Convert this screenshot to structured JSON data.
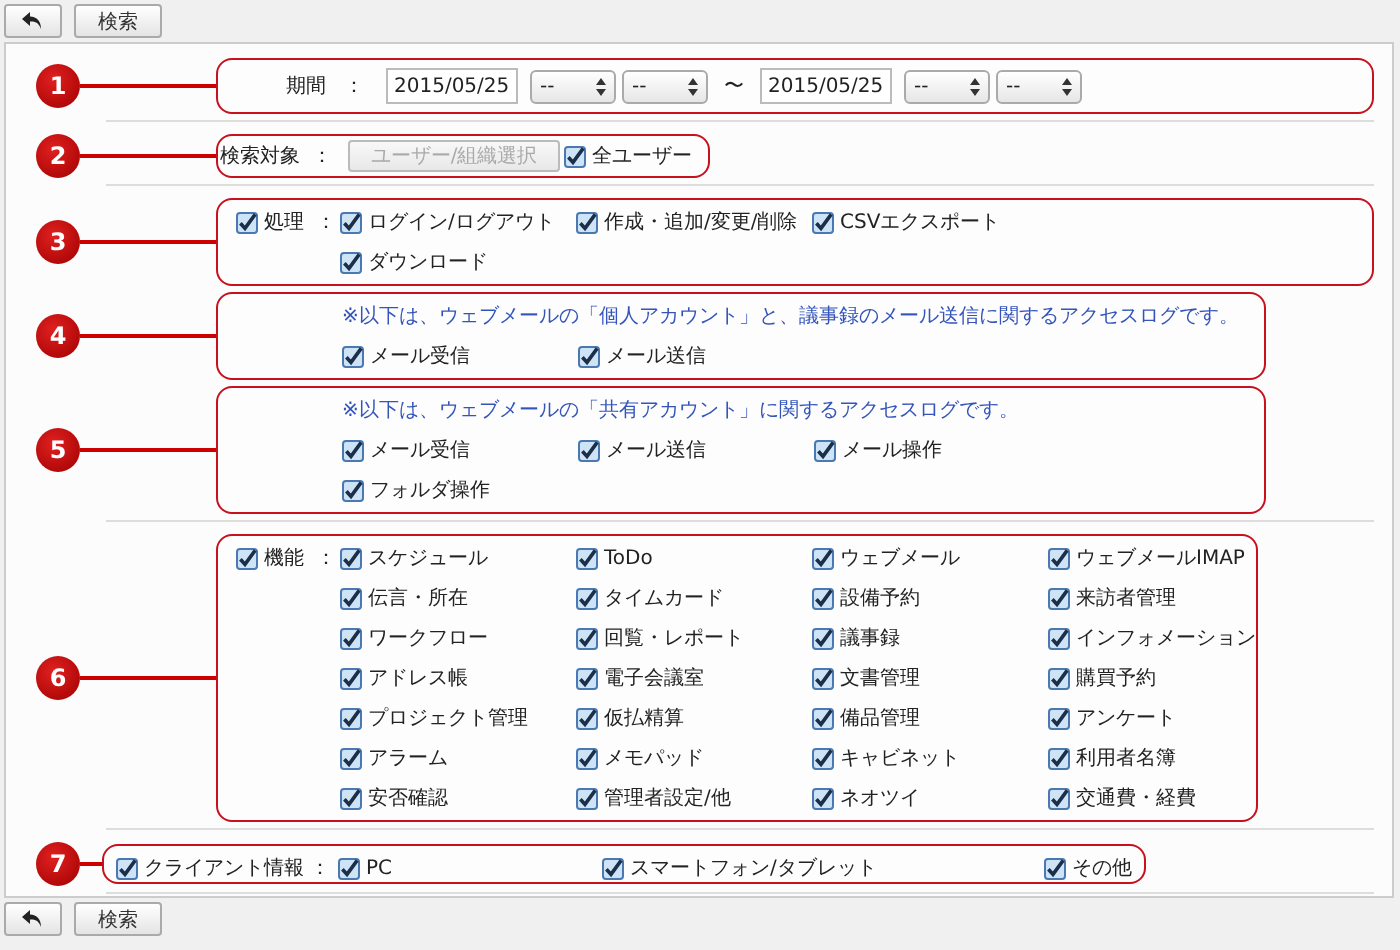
{
  "top_toolbar": {
    "search_button": "検索"
  },
  "rows": [
    {
      "sections": [
        {
          "kind": "period",
          "number": "1",
          "label": "期間",
          "colon": "：",
          "from": {
            "date": "2015/05/25",
            "hour": "--",
            "minute": "--"
          },
          "tilde": "〜",
          "to": {
            "date": "2015/05/25",
            "hour": "--",
            "minute": "--"
          }
        }
      ]
    },
    {
      "sections": [
        {
          "kind": "target",
          "number": "2",
          "label": "検索対象",
          "colon": "：",
          "button": {
            "label": "ユーザー/組織選択",
            "disabled": true
          },
          "all_users": {
            "label": "全ユーザー",
            "checked": true
          }
        }
      ]
    },
    {
      "sections": [
        {
          "kind": "checks",
          "number": "3",
          "label": "処理",
          "checked": true,
          "colon": "：",
          "items": [
            {
              "label": "ログイン/ログアウト",
              "checked": true
            },
            {
              "label": "作成・追加/変更/削除",
              "checked": true
            },
            {
              "label": "CSVエクスポート",
              "checked": true
            },
            {
              "label": "ダウンロード",
              "checked": true
            }
          ]
        },
        {
          "kind": "notice",
          "number": "4",
          "note": "※以下は、ウェブメールの「個人アカウント」と、議事録のメール送信に関するアクセスログです。",
          "items": [
            {
              "label": "メール受信",
              "checked": true
            },
            {
              "label": "メール送信",
              "checked": true
            }
          ]
        },
        {
          "kind": "notice",
          "number": "5",
          "note": "※以下は、ウェブメールの「共有アカウント」に関するアクセスログです。",
          "items": [
            {
              "label": "メール受信",
              "checked": true
            },
            {
              "label": "メール送信",
              "checked": true
            },
            {
              "label": "メール操作",
              "checked": true
            },
            {
              "label": "フォルダ操作",
              "checked": true
            }
          ]
        }
      ]
    },
    {
      "sections": [
        {
          "kind": "checks",
          "number": "6",
          "label": "機能",
          "checked": true,
          "colon": "：",
          "items": [
            {
              "label": "スケジュール",
              "checked": true
            },
            {
              "label": "ToDo",
              "checked": true
            },
            {
              "label": "ウェブメール",
              "checked": true
            },
            {
              "label": "ウェブメールIMAP",
              "checked": true
            },
            {
              "label": "伝言・所在",
              "checked": true
            },
            {
              "label": "タイムカード",
              "checked": true
            },
            {
              "label": "設備予約",
              "checked": true
            },
            {
              "label": "来訪者管理",
              "checked": true
            },
            {
              "label": "ワークフロー",
              "checked": true
            },
            {
              "label": "回覧・レポート",
              "checked": true
            },
            {
              "label": "議事録",
              "checked": true
            },
            {
              "label": "インフォメーション",
              "checked": true
            },
            {
              "label": "アドレス帳",
              "checked": true
            },
            {
              "label": "電子会議室",
              "checked": true
            },
            {
              "label": "文書管理",
              "checked": true
            },
            {
              "label": "購買予約",
              "checked": true
            },
            {
              "label": "プロジェクト管理",
              "checked": true
            },
            {
              "label": "仮払精算",
              "checked": true
            },
            {
              "label": "備品管理",
              "checked": true
            },
            {
              "label": "アンケート",
              "checked": true
            },
            {
              "label": "アラーム",
              "checked": true
            },
            {
              "label": "メモパッド",
              "checked": true
            },
            {
              "label": "キャビネット",
              "checked": true
            },
            {
              "label": "利用者名簿",
              "checked": true
            },
            {
              "label": "安否確認",
              "checked": true
            },
            {
              "label": "管理者設定/他",
              "checked": true
            },
            {
              "label": "ネオツイ",
              "checked": true
            },
            {
              "label": "交通費・経費",
              "checked": true
            }
          ]
        }
      ]
    },
    {
      "sections": [
        {
          "kind": "client",
          "number": "7",
          "label": "クライアント情報",
          "checked": true,
          "colon": "：",
          "items": [
            {
              "label": "PC",
              "checked": true
            },
            {
              "label": "スマートフォン/タブレット",
              "checked": true
            },
            {
              "label": "その他",
              "checked": true
            }
          ]
        }
      ]
    }
  ],
  "bottom_toolbar": {
    "search_button": "検索"
  }
}
